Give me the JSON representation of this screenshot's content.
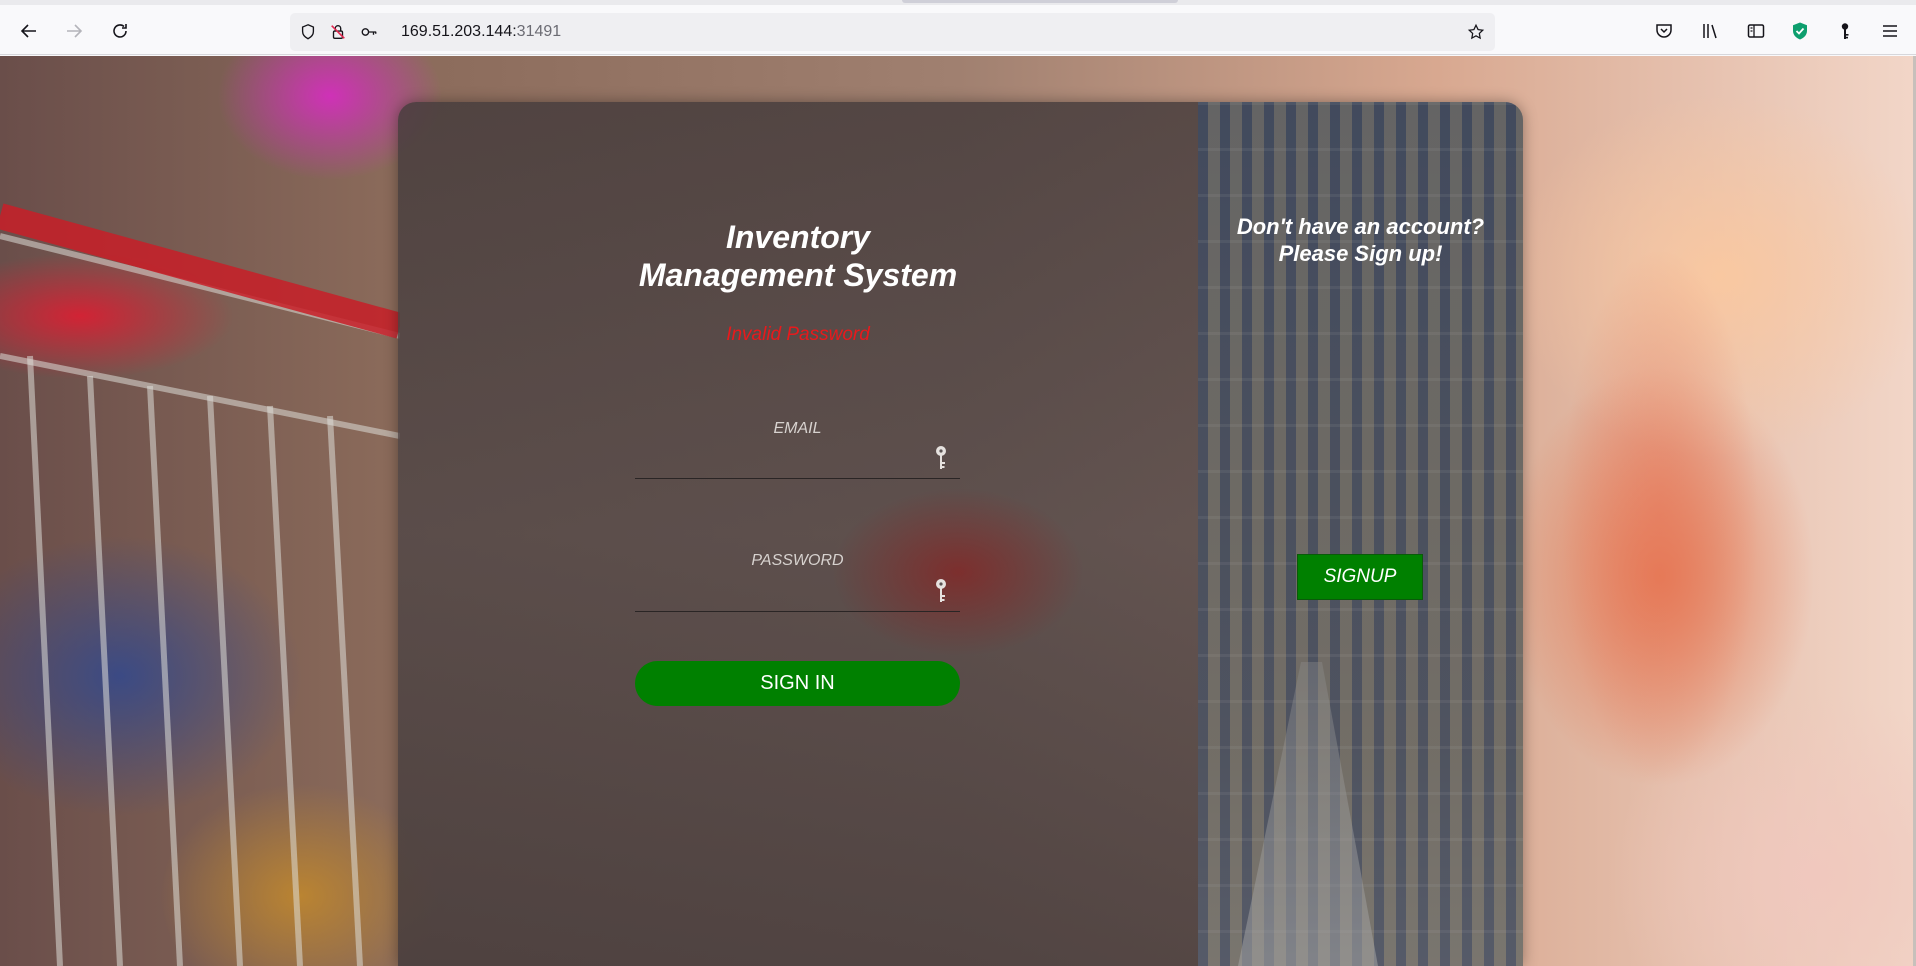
{
  "browser": {
    "url_host": "169.51.203.144:",
    "url_port": "31491",
    "icons": {
      "back": "back-arrow-icon",
      "forward": "forward-arrow-icon",
      "reload": "reload-icon",
      "shield": "tracking-shield-icon",
      "insecure": "insecure-lock-icon",
      "permissions": "key-permissions-icon",
      "bookmark": "bookmark-star-icon",
      "pocket": "pocket-icon",
      "library": "library-icon",
      "sidebar": "sidebar-icon",
      "extension_shield": "extension-shield-icon",
      "extension_key": "extension-key-icon",
      "menu": "hamburger-menu-icon"
    }
  },
  "login": {
    "title_line1": "Inventory",
    "title_line2": "Management System",
    "error_message": "Invalid Password",
    "email_label": "EMAIL",
    "email_value": "",
    "password_label": "PASSWORD",
    "password_value": "",
    "signin_label": "SIGN IN"
  },
  "signup_panel": {
    "prompt_line1": "Don't have an account?",
    "prompt_line2": "Please Sign up!",
    "signup_label": "SIGNUP"
  },
  "colors": {
    "accent_green": "#008000",
    "error_red": "#e8191c",
    "text_white": "#ffffff"
  }
}
